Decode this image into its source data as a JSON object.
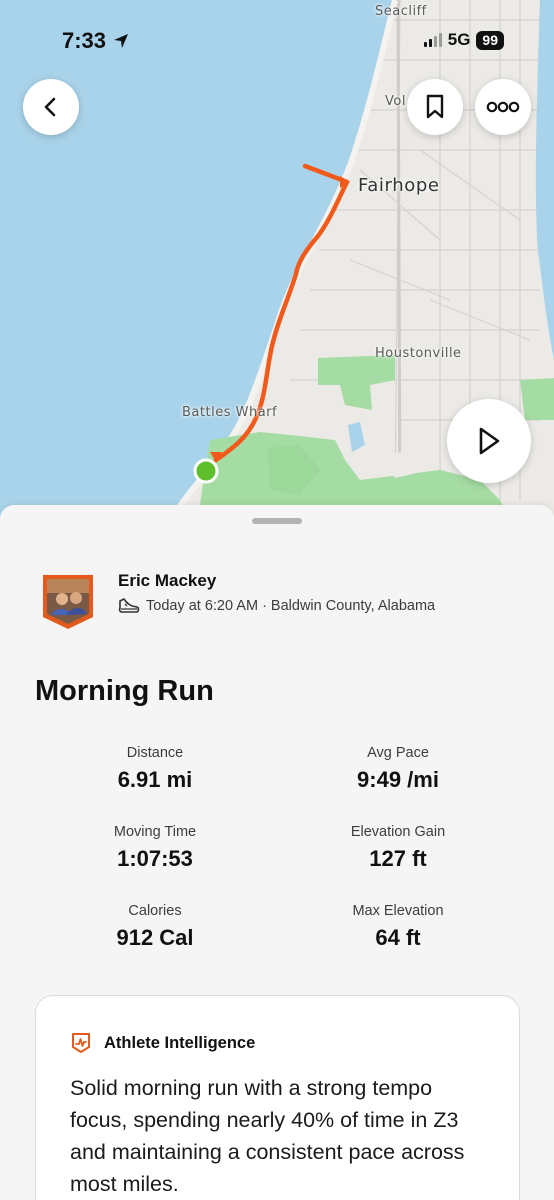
{
  "status_bar": {
    "time": "7:33",
    "network": "5G",
    "battery": "99"
  },
  "map": {
    "labels": {
      "seacliff": "Seacliff",
      "volanta": "Vol",
      "fairhope": "Fairhope",
      "houstonville": "Houstonville",
      "battles_wharf": "Battles Wharf"
    },
    "colors": {
      "water": "#a9d3ea",
      "land": "#eceae6",
      "park": "#a5dca3",
      "route": "#f25a1c",
      "start": "#5fbe2c"
    }
  },
  "activity": {
    "athlete_name": "Eric Mackey",
    "meta": "Today at 6:20 AM · Baldwin County, Alabama",
    "title": "Morning Run",
    "stats": [
      {
        "label": "Distance",
        "value": "6.91 mi"
      },
      {
        "label": "Avg Pace",
        "value": "9:49 /mi"
      },
      {
        "label": "Moving Time",
        "value": "1:07:53"
      },
      {
        "label": "Elevation Gain",
        "value": "127 ft"
      },
      {
        "label": "Calories",
        "value": "912 Cal"
      },
      {
        "label": "Max Elevation",
        "value": "64 ft"
      }
    ]
  },
  "athlete_intelligence": {
    "heading": "Athlete Intelligence",
    "text": "Solid morning run with a strong tempo focus, spending nearly 40% of time in Z3 and maintaining a consistent pace across most miles."
  },
  "icons": {
    "back": "chevron-left-icon",
    "bookmark": "bookmark-icon",
    "more": "more-dots-icon",
    "play": "play-icon",
    "location": "location-arrow-icon",
    "shoe": "shoe-icon",
    "ai": "athlete-intelligence-icon"
  }
}
